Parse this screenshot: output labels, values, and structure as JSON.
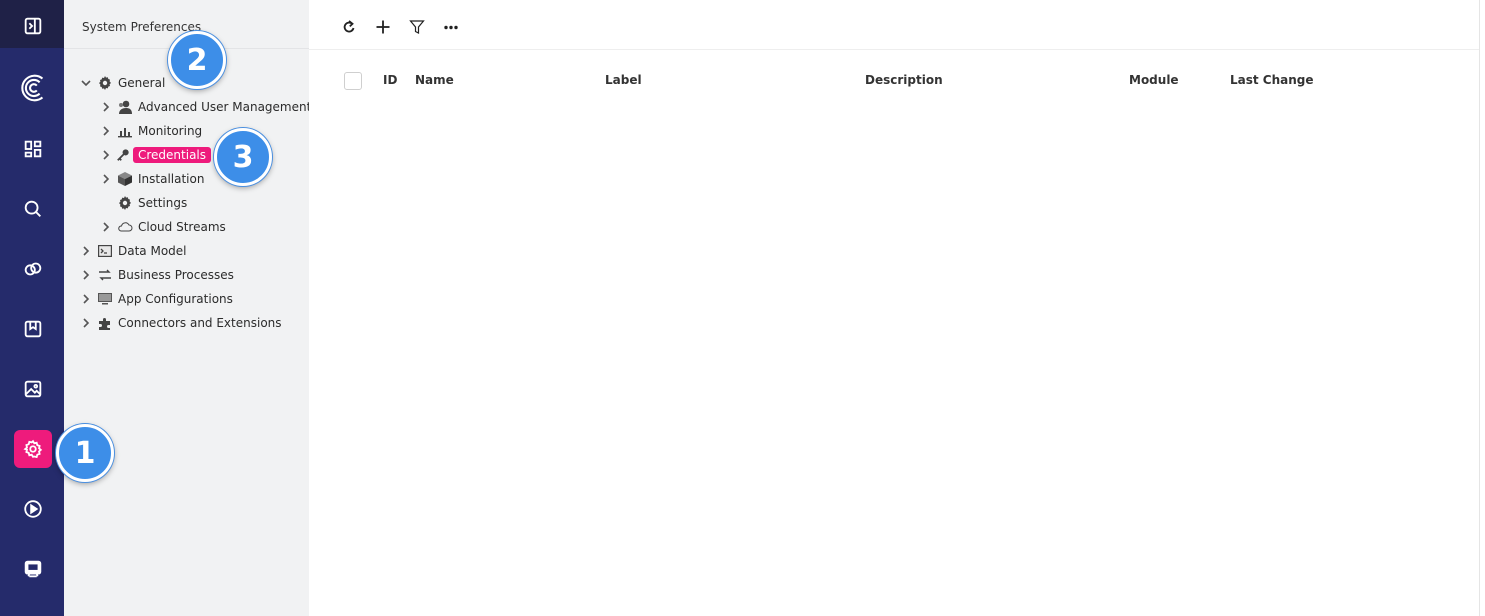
{
  "rail": {
    "items": [
      {
        "name": "toggle-panel",
        "icon": "sidebar-toggle-icon"
      },
      {
        "name": "logo",
        "icon": "brand-logo-icon"
      },
      {
        "name": "dashboard",
        "icon": "dashboard-icon"
      },
      {
        "name": "search",
        "icon": "search-icon"
      },
      {
        "name": "links",
        "icon": "link-icon"
      },
      {
        "name": "bookmarks",
        "icon": "bookmark-icon"
      },
      {
        "name": "images",
        "icon": "image-icon"
      },
      {
        "name": "system-preferences",
        "icon": "gear-icon",
        "active": true
      },
      {
        "name": "play",
        "icon": "play-icon"
      },
      {
        "name": "monitor",
        "icon": "device-icon"
      }
    ],
    "accent_color": "#ee1b7c",
    "background_color": "#252b6b"
  },
  "tree": {
    "title": "System Preferences",
    "items": [
      {
        "label": "General",
        "icon": "gear-icon",
        "expanded": true
      },
      {
        "label": "Advanced User Management",
        "icon": "user-icon"
      },
      {
        "label": "Monitoring",
        "icon": "bar-chart-icon"
      },
      {
        "label": "Credentials",
        "icon": "key-icon",
        "selected": true
      },
      {
        "label": "Installation",
        "icon": "box-icon"
      },
      {
        "label": "Settings",
        "icon": "gear-icon"
      },
      {
        "label": "Cloud Streams",
        "icon": "cloud-icon"
      },
      {
        "label": "Data Model",
        "icon": "terminal-icon"
      },
      {
        "label": "Business Processes",
        "icon": "process-icon"
      },
      {
        "label": "App Configurations",
        "icon": "monitor-icon"
      },
      {
        "label": "Connectors and Extensions",
        "icon": "puzzle-icon"
      }
    ]
  },
  "toolbar": {
    "buttons": [
      "refresh-icon",
      "plus-icon",
      "filter-icon",
      "more-icon"
    ]
  },
  "table": {
    "columns": [
      "ID",
      "Name",
      "Label",
      "Description",
      "Module",
      "Last Change"
    ],
    "rows": []
  },
  "callouts": [
    "1",
    "2",
    "3"
  ]
}
